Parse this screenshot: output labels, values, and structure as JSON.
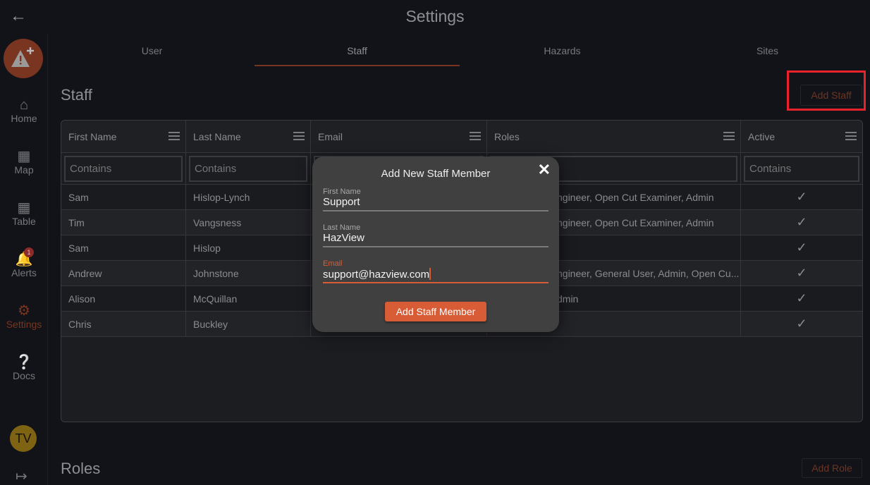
{
  "header": {
    "title": "Settings"
  },
  "sidebar": {
    "items": [
      {
        "label": "Home",
        "icon": "home-icon"
      },
      {
        "label": "Map",
        "icon": "map-icon"
      },
      {
        "label": "Table",
        "icon": "table-icon"
      },
      {
        "label": "Alerts",
        "icon": "bell-icon",
        "badge": "1"
      },
      {
        "label": "Settings",
        "icon": "gear-icon"
      },
      {
        "label": "Docs",
        "icon": "help-icon"
      }
    ],
    "avatar": "TV"
  },
  "tabs": [
    "User",
    "Staff",
    "Hazards",
    "Sites"
  ],
  "staff": {
    "title": "Staff",
    "add_label": "Add Staff",
    "columns": [
      "First Name",
      "Last Name",
      "Email",
      "Roles",
      "Active"
    ],
    "filter_placeholder": "Contains",
    "rows": [
      {
        "first": "Sam",
        "last": "Hislop-Lynch",
        "roles": "ngineer, Open Cut Examiner, Admin",
        "active": "✓"
      },
      {
        "first": "Tim",
        "last": "Vangsness",
        "roles": "ngineer, Open Cut Examiner, Admin",
        "active": "✓"
      },
      {
        "first": "Sam",
        "last": "Hislop",
        "roles": "",
        "active": "✓"
      },
      {
        "first": "Andrew",
        "last": "Johnstone",
        "roles": "ngineer, General User, Admin, Open Cu...",
        "active": "✓"
      },
      {
        "first": "Alison",
        "last": "McQuillan",
        "roles": "dmin",
        "active": "✓"
      },
      {
        "first": "Chris",
        "last": "Buckley",
        "roles": "",
        "active": "✓"
      }
    ]
  },
  "roles": {
    "title": "Roles",
    "add_label": "Add Role"
  },
  "modal": {
    "title": "Add New Staff Member",
    "first_label": "First Name",
    "first_value": "Support",
    "last_label": "Last Name",
    "last_value": "HazView",
    "email_label": "Email",
    "email_value": "support@hazview.com",
    "submit": "Add Staff Member"
  },
  "colors": {
    "accent": "#d85c35",
    "highlight": "#e8222a"
  }
}
